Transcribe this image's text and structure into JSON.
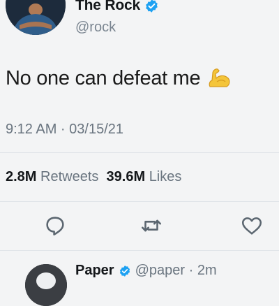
{
  "tweet": {
    "display_name": "The Rock",
    "handle": "@rock",
    "text": "No one can defeat me",
    "emoji_icon": "flexed-biceps-icon",
    "timestamp": "9:12 AM · 03/15/21",
    "retweets_count": "2.8M",
    "retweets_label": "Retweets",
    "likes_count": "39.6M",
    "likes_label": "Likes"
  },
  "actions": {
    "reply_icon": "comment-icon",
    "retweet_icon": "retweet-icon",
    "like_icon": "heart-icon"
  },
  "reply": {
    "display_name": "Paper",
    "handle_time": "@paper · 2m"
  },
  "colors": {
    "verified_blue": "#1da1f2",
    "background": "#f3f4f5",
    "secondary_text": "#69747f"
  }
}
